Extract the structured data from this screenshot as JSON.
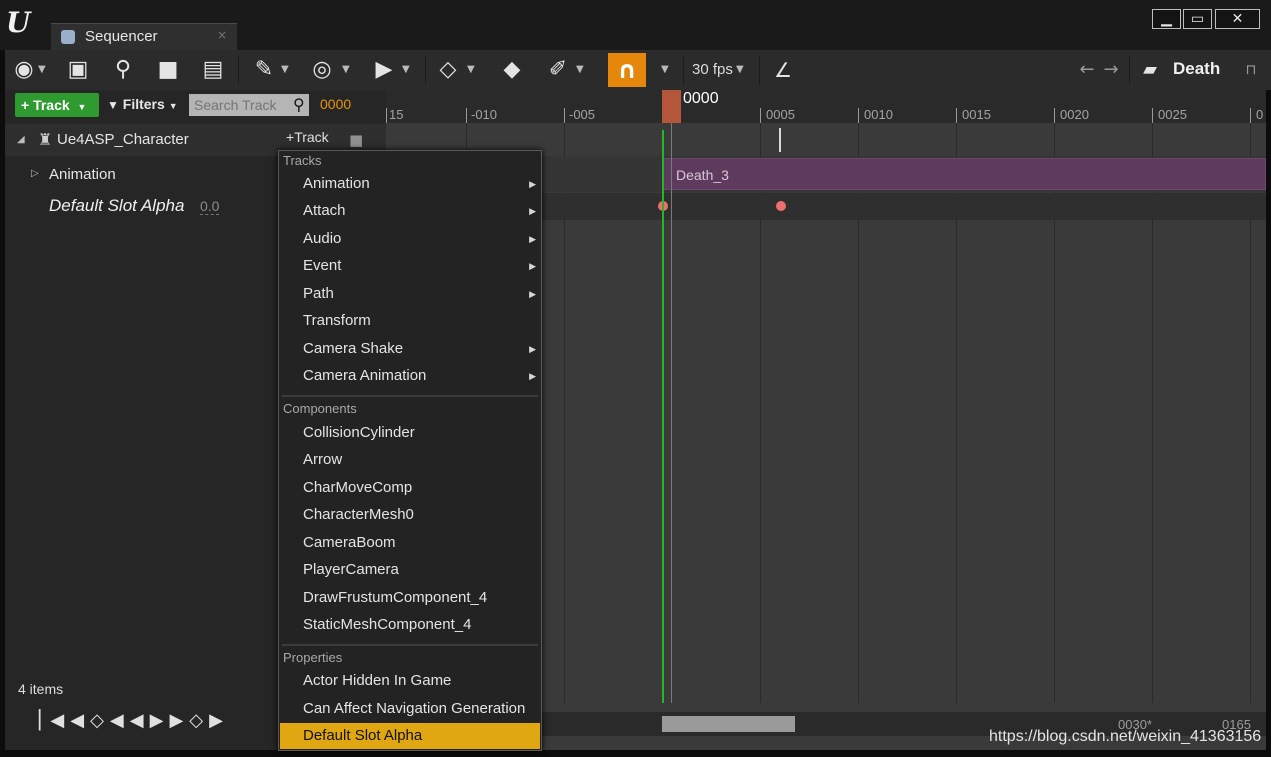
{
  "window": {
    "tab_title": "Sequencer",
    "tab_close": "×",
    "minimize": "▁",
    "maximize": "▭",
    "close": "✕"
  },
  "toolbar": {
    "fps": "30 fps",
    "sequence_name": "Death",
    "snap_active_color": "#e5870a"
  },
  "left_panel": {
    "add_track_label": "+ Track",
    "filters_label": "Filters",
    "search_placeholder": "Search Track",
    "current_time": "0000",
    "character_label": "Ue4ASP_Character",
    "character_track_btn": "Track",
    "animation_label": "Animation",
    "slot_label": "Default Slot Alpha",
    "slot_value": "0.0",
    "items_count": "4 items"
  },
  "timeline": {
    "playhead_label": "0000",
    "ticks": [
      "15",
      "-010",
      "-005",
      "0005",
      "0010",
      "0015",
      "0020",
      "0025",
      "0"
    ],
    "section_label": "Death_3",
    "range_end": "0030*",
    "range_end2": "0165",
    "watermark": "https://blog.csdn.net/weixin_41363156"
  },
  "menu": {
    "tracks_heading": "Tracks",
    "tracks": [
      {
        "label": "Animation",
        "submenu": true
      },
      {
        "label": "Attach",
        "submenu": true
      },
      {
        "label": "Audio",
        "submenu": true
      },
      {
        "label": "Event",
        "submenu": true
      },
      {
        "label": "Path",
        "submenu": true
      },
      {
        "label": "Transform",
        "submenu": false
      },
      {
        "label": "Camera Shake",
        "submenu": true
      },
      {
        "label": "Camera Animation",
        "submenu": true
      }
    ],
    "components_heading": "Components",
    "components": [
      "CollisionCylinder",
      "Arrow",
      "CharMoveComp",
      "CharacterMesh0",
      "CameraBoom",
      "PlayerCamera",
      "DrawFrustumComponent_4",
      "StaticMeshComponent_4"
    ],
    "properties_heading": "Properties",
    "properties": [
      "Actor Hidden In Game",
      "Can Affect Navigation Generation",
      "Default Slot Alpha"
    ],
    "highlighted_item": "Default Slot Alpha",
    "highlight_color": "#e0a713"
  }
}
